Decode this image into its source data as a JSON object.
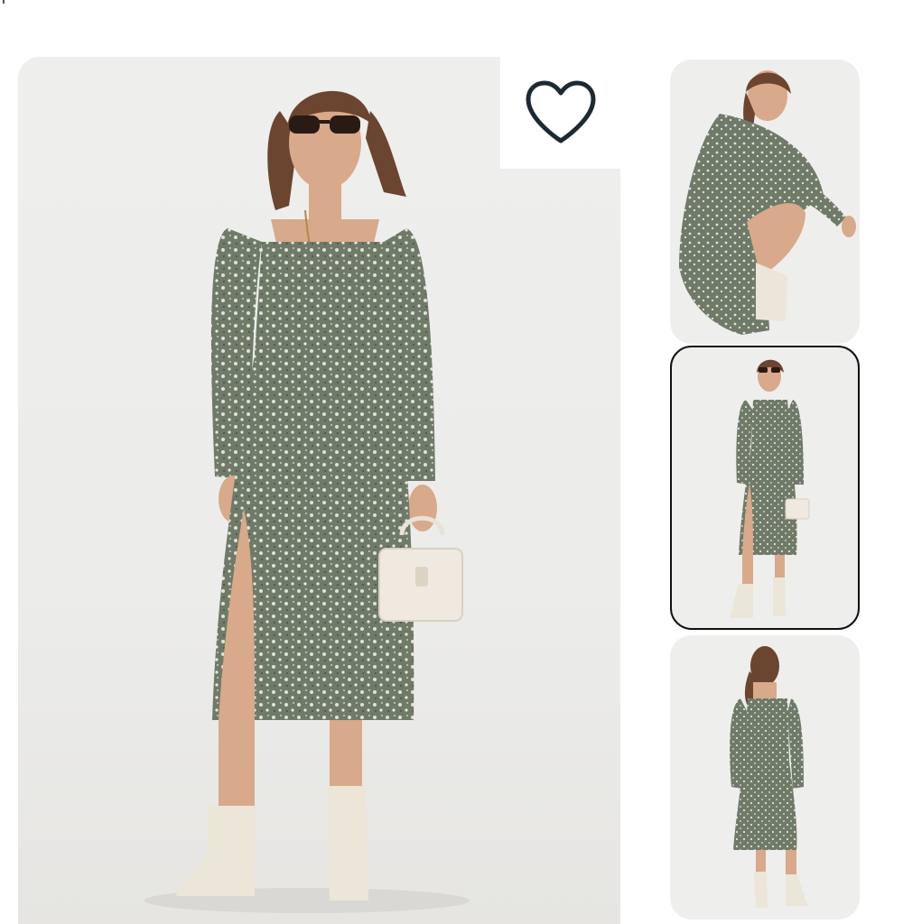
{
  "gallery": {
    "main_image": {
      "icon": "dress-photo-front",
      "description_icon": "photo"
    },
    "favorite": {
      "icon": "heart-outline-icon",
      "color": "#1c2a33"
    },
    "thumbnails": [
      {
        "icon": "photo-crouching",
        "selected": false
      },
      {
        "icon": "photo-front",
        "selected": true
      },
      {
        "icon": "photo-back",
        "selected": false
      }
    ]
  },
  "colors": {
    "dress": "#6f7a68",
    "dress_pattern": "#dfe3d6",
    "skin": "#d8a98a",
    "hair": "#6b4530",
    "boots": "#ece6d8",
    "bag": "#efe9df",
    "background": "#eeeeec",
    "selected_border": "#111111"
  }
}
